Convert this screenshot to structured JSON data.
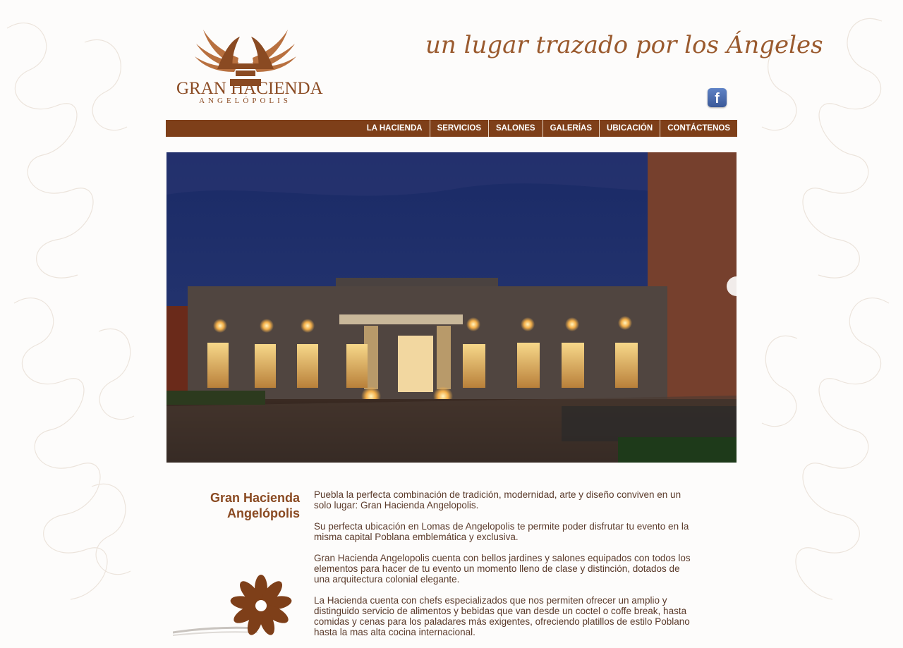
{
  "brand": {
    "name": "GRAN HACIENDA",
    "subtitle": "ANGELÓPOLIS",
    "tagline": "un lugar trazado por los Ángeles",
    "accent_color": "#7e3f19"
  },
  "social": {
    "icon": "facebook-icon",
    "glyph": "f"
  },
  "nav": {
    "items": [
      {
        "label": "LA HACIENDA"
      },
      {
        "label": "SERVICIOS"
      },
      {
        "label": "SALONES"
      },
      {
        "label": "GALERÍAS"
      },
      {
        "label": "UBICACIÓN"
      },
      {
        "label": "CONTÁCTENOS"
      }
    ]
  },
  "hero": {
    "subject": "hacienda-building-night-photo"
  },
  "intro": {
    "title_line1": "Gran Hacienda",
    "title_line2": "Angelópolis",
    "paragraphs": [
      "Puebla la perfecta combinación de tradición, modernidad, arte y diseño conviven en un solo lugar: Gran Hacienda Angelopolis.",
      "Su perfecta ubicación en Lomas de Angelopolis te permite poder disfrutar tu evento en la misma capital Poblana emblemática y exclusiva.",
      "Gran Hacienda Angelopolis cuenta con bellos jardines y salones equipados con todos los elementos para hacer de tu evento un momento lleno de clase y distinción, dotados de una arquitectura colonial elegante.",
      "La Hacienda cuenta con chefs especializados que nos permiten ofrecer un amplio y distinguido servicio de alimentos y bebidas que van desde un coctel o coffe break, hasta comidas y cenas para los paladares más exigentes, ofreciendo platillos de estilo Poblano hasta la mas alta cocina internacional."
    ]
  }
}
